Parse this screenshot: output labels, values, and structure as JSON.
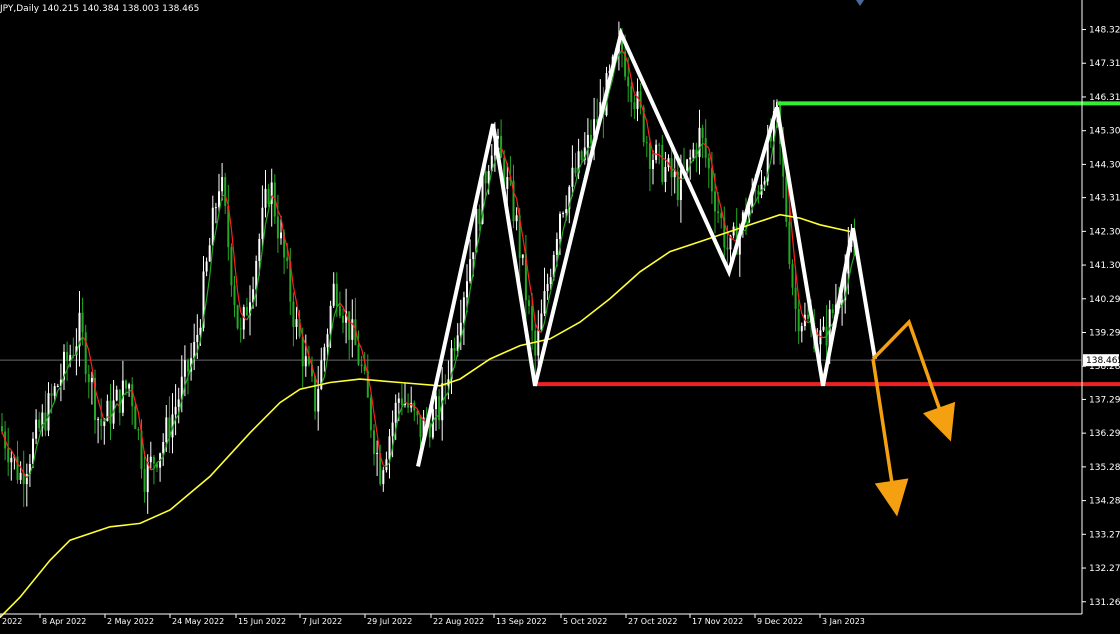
{
  "ticker": {
    "symbol": "JPY,Daily",
    "ohlc": "140.215 140.384 138.003 138.465"
  },
  "chart_data": {
    "type": "candlestick",
    "title": "",
    "xlabel": "",
    "ylabel": "",
    "ylim": [
      130.9,
      149.2
    ],
    "x_ticks": [
      "2022",
      "8 Apr 2022",
      "2 May 2022",
      "24 May 2022",
      "15 Jun 2022",
      "7 Jul 2022",
      "29 Jul 2022",
      "22 Aug 2022",
      "13 Sep 2022",
      "5 Oct 2022",
      "27 Oct 2022",
      "17 Nov 2022",
      "9 Dec 2022",
      "3 Jan 2023"
    ],
    "y_ticks": [
      148.32,
      147.315,
      146.31,
      145.305,
      144.3,
      143.31,
      142.305,
      141.3,
      140.295,
      139.29,
      138.285,
      137.295,
      136.29,
      135.285,
      134.28,
      133.275,
      132.27,
      131.265
    ],
    "y_tick_labels": [
      "148.320",
      "147.315",
      "146.310",
      "145.305",
      "144.300",
      "143.310",
      "142.305",
      "141.300",
      "140.295",
      "139.290",
      "138.285",
      "137.295",
      "136.290",
      "135.285",
      "134.280",
      "133.275",
      "132.270",
      "131.265"
    ],
    "current_price": 138.465,
    "current_price_label": "138.465",
    "colors": {
      "background": "#000000",
      "bull_candle": "#ffffff",
      "bear_candle": "#22aa22",
      "fast_ma": "#ff2020",
      "slow_ma": "#ffff33",
      "pattern": "#ffffff",
      "resistance": "#33ee33",
      "support": "#ee2222",
      "projection": "#f5a010",
      "axis_text": "#ffffff"
    },
    "slow_ma": [
      [
        0,
        130.8
      ],
      [
        20,
        131.4
      ],
      [
        50,
        132.5
      ],
      [
        70,
        133.1
      ],
      [
        110,
        133.5
      ],
      [
        140,
        133.6
      ],
      [
        170,
        134.0
      ],
      [
        210,
        135.0
      ],
      [
        250,
        136.3
      ],
      [
        280,
        137.2
      ],
      [
        300,
        137.6
      ],
      [
        330,
        137.8
      ],
      [
        360,
        137.9
      ],
      [
        400,
        137.8
      ],
      [
        440,
        137.7
      ],
      [
        460,
        137.9
      ],
      [
        490,
        138.5
      ],
      [
        520,
        138.9
      ],
      [
        550,
        139.1
      ],
      [
        580,
        139.6
      ],
      [
        610,
        140.3
      ],
      [
        640,
        141.1
      ],
      [
        670,
        141.7
      ],
      [
        700,
        142.0
      ],
      [
        730,
        142.3
      ],
      [
        760,
        142.6
      ],
      [
        780,
        142.8
      ],
      [
        800,
        142.7
      ],
      [
        820,
        142.5
      ],
      [
        850,
        142.3
      ]
    ],
    "pattern_zigzag": [
      [
        418,
        135.3
      ],
      [
        493,
        145.5
      ],
      [
        535,
        137.7
      ],
      [
        621,
        148.2
      ],
      [
        729,
        141.1
      ],
      [
        777,
        146.0
      ],
      [
        823,
        137.7
      ],
      [
        853,
        142.4
      ],
      [
        875,
        138.5
      ]
    ],
    "resistance_level": 146.12,
    "support_level": 137.75,
    "projection_wedge": [
      [
        873,
        138.5
      ],
      [
        909,
        139.6
      ],
      [
        942,
        136.8
      ]
    ],
    "projection_arrow": [
      [
        873,
        138.5
      ],
      [
        893,
        134.6
      ]
    ]
  }
}
